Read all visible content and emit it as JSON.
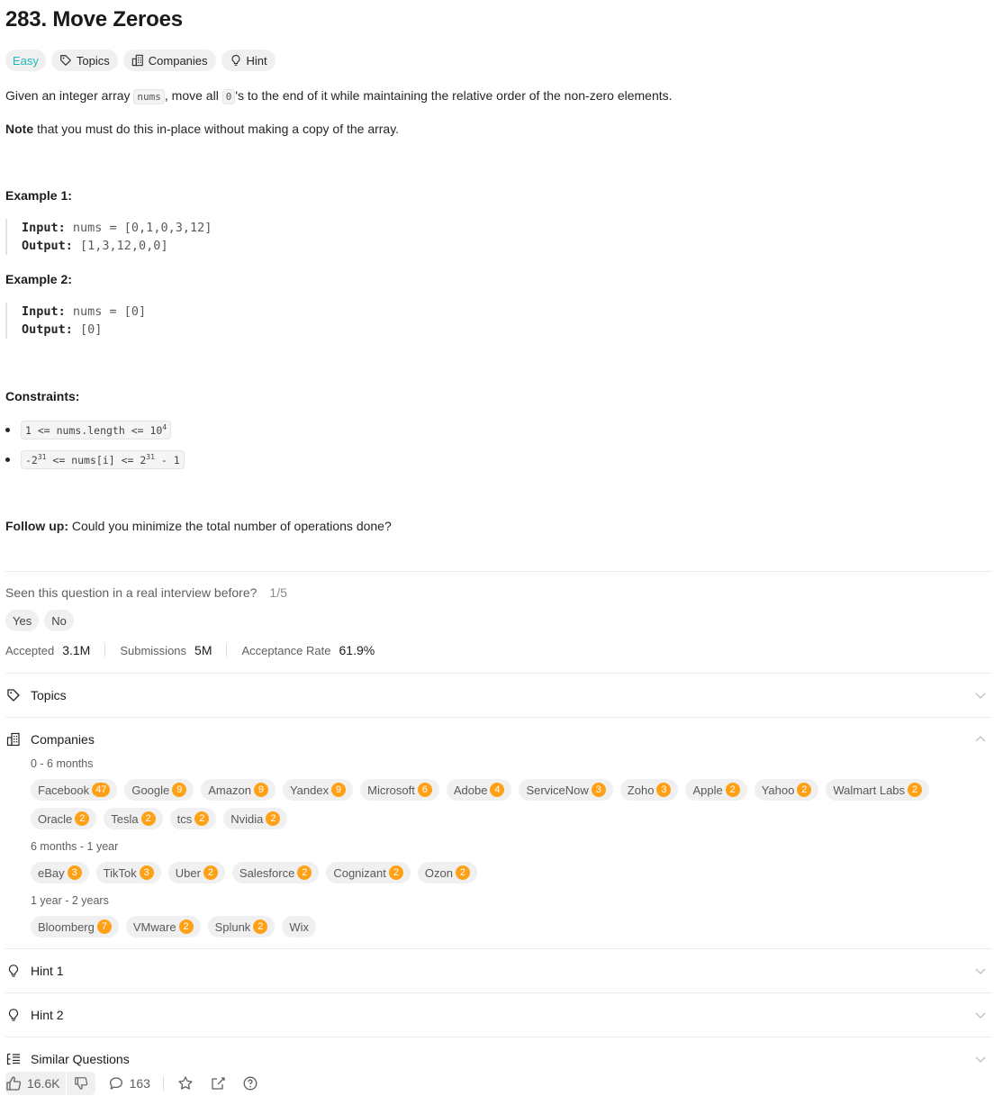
{
  "problem": {
    "title": "283. Move Zeroes",
    "difficulty": "Easy",
    "tags": {
      "topics": "Topics",
      "companies": "Companies",
      "hint": "Hint"
    },
    "desc_a": "Given an integer array ",
    "desc_code1": "nums",
    "desc_b": ", move all ",
    "desc_code2": "0",
    "desc_c": "'s to the end of it while maintaining the relative order of the non-zero elements.",
    "note_bold": "Note",
    "note_rest": " that you must do this in-place without making a copy of the array."
  },
  "examples": [
    {
      "title": "Example 1:",
      "input_label": "Input:",
      "input": " nums = [0,1,0,3,12]",
      "output_label": "Output:",
      "output": " [1,3,12,0,0]"
    },
    {
      "title": "Example 2:",
      "input_label": "Input:",
      "input": " nums = [0]",
      "output_label": "Output:",
      "output": " [0]"
    }
  ],
  "constraints": {
    "title": "Constraints:",
    "c1_a": "1 <= nums.length <= 10",
    "c1_sup": "4",
    "c2_a": "-2",
    "c2_sup1": "31",
    "c2_b": " <= nums[i] <= 2",
    "c2_sup2": "31",
    "c2_c": " - 1"
  },
  "followup": {
    "bold": "Follow up:",
    "text": " Could you minimize the total number of operations done?"
  },
  "interview": {
    "question": "Seen this question in a real interview before?",
    "fraction": "1/5",
    "yes": "Yes",
    "no": "No"
  },
  "stats": {
    "accepted_label": "Accepted",
    "accepted": "3.1M",
    "submissions_label": "Submissions",
    "submissions": "5M",
    "rate_label": "Acceptance Rate",
    "rate": "61.9%"
  },
  "sections": {
    "topics": "Topics",
    "companies": "Companies",
    "hint1": "Hint 1",
    "hint2": "Hint 2",
    "similar": "Similar Questions"
  },
  "companies": {
    "periods": [
      "0 - 6 months",
      "6 months - 1 year",
      "1 year - 2 years"
    ],
    "p0_row1": [
      {
        "name": "Facebook",
        "count": "47"
      },
      {
        "name": "Google",
        "count": "9"
      },
      {
        "name": "Amazon",
        "count": "9"
      },
      {
        "name": "Yandex",
        "count": "9"
      },
      {
        "name": "Microsoft",
        "count": "6"
      },
      {
        "name": "Adobe",
        "count": "4"
      },
      {
        "name": "ServiceNow",
        "count": "3"
      },
      {
        "name": "Zoho",
        "count": "3"
      },
      {
        "name": "Apple",
        "count": "2"
      },
      {
        "name": "Yahoo",
        "count": "2"
      },
      {
        "name": "Walmart Labs",
        "count": "2"
      }
    ],
    "p0_row2": [
      {
        "name": "Oracle",
        "count": "2"
      },
      {
        "name": "Tesla",
        "count": "2"
      },
      {
        "name": "tcs",
        "count": "2"
      },
      {
        "name": "Nvidia",
        "count": "2"
      }
    ],
    "p1": [
      {
        "name": "eBay",
        "count": "3"
      },
      {
        "name": "TikTok",
        "count": "3"
      },
      {
        "name": "Uber",
        "count": "2"
      },
      {
        "name": "Salesforce",
        "count": "2"
      },
      {
        "name": "Cognizant",
        "count": "2"
      },
      {
        "name": "Ozon",
        "count": "2"
      }
    ],
    "p2": [
      {
        "name": "Bloomberg",
        "count": "7"
      },
      {
        "name": "VMware",
        "count": "2"
      },
      {
        "name": "Splunk",
        "count": "2"
      },
      {
        "name": "Wix",
        "count": ""
      }
    ]
  },
  "footer": {
    "likes": "16.6K",
    "comments": "163"
  },
  "colors": {
    "easy": "#1cbaba",
    "badge": "#ffa116"
  }
}
